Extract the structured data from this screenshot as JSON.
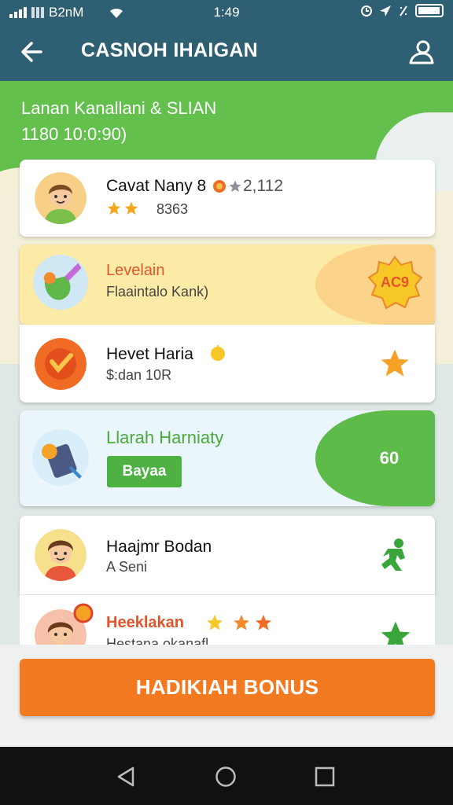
{
  "status_bar": {
    "carrier": "B2nM",
    "time": "1:49"
  },
  "app_bar": {
    "title": "CASNOH IHAIGAN",
    "back_icon": "back-arrow-icon",
    "profile_icon": "profile-icon"
  },
  "banner": {
    "title": "Lanan Kanallani & SLIAN",
    "subtitle": "1180 10:0:90)"
  },
  "cards": [
    {
      "name": "Cavat Nany 8",
      "score": "2,112",
      "sub": "8363",
      "rating": 2
    },
    {
      "name": "Levelain",
      "sub": "Flaaintalo Kank)",
      "badge": "AC9"
    },
    {
      "name": "Hevet Haria",
      "sub": "$:dan 10R"
    },
    {
      "name": "Llarah Harniaty",
      "button": "Bayaa",
      "value": "60"
    },
    {
      "name": "Haajmr Bodan",
      "sub": "A Seni"
    },
    {
      "name": "Heeklakan",
      "sub": "Hestana okanafl",
      "rating": 3
    }
  ],
  "bonus_button": "HADIKIAH BONUS",
  "colors": {
    "app_bar": "#2f5f73",
    "banner_green": "#63c04d",
    "accent_orange": "#f47a22",
    "highlight_yellow": "#fbeba7",
    "highlight_green": "#5dbb4a"
  }
}
